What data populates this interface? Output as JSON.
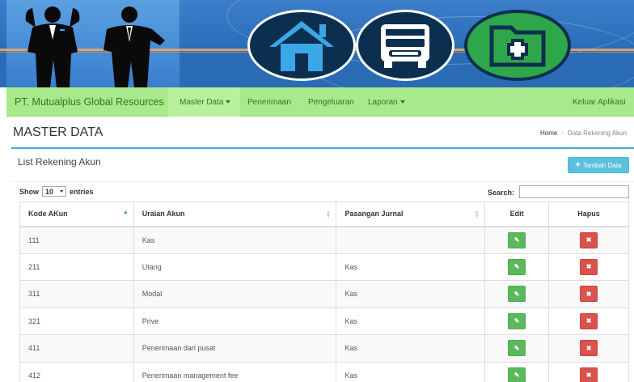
{
  "navbar": {
    "brand": "PT. Mutualplus Global Resources",
    "items": [
      {
        "label": "Master Data",
        "dropdown": true
      },
      {
        "label": "Penerimaan",
        "dropdown": false
      },
      {
        "label": "Pengeluaran",
        "dropdown": false
      },
      {
        "label": "Laporan",
        "dropdown": true
      }
    ],
    "logout": "Keluar Aplikasi"
  },
  "page": {
    "title": "MASTER DATA",
    "breadcrumb": {
      "home": "Home",
      "current": "Data Rekening Akun"
    }
  },
  "panel": {
    "title": "List Rekening Akun",
    "add_button": "Tambah Data",
    "show_label": "Show",
    "entries_value": "10",
    "entries_label": "entries",
    "search_label": "Search:",
    "search_value": ""
  },
  "table": {
    "headers": [
      "Kode AKun",
      "Uraian Akun",
      "Pasangan Jurnal",
      "Edit",
      "Hapus"
    ],
    "rows": [
      {
        "kode": "111",
        "uraian": "Kas",
        "pasangan": ""
      },
      {
        "kode": "211",
        "uraian": "Utang",
        "pasangan": "Kas"
      },
      {
        "kode": "311",
        "uraian": "Modal",
        "pasangan": "Kas"
      },
      {
        "kode": "321",
        "uraian": "Prive",
        "pasangan": "Kas"
      },
      {
        "kode": "411",
        "uraian": "Penerimaan dari pusat",
        "pasangan": "Kas"
      },
      {
        "kode": "412",
        "uraian": "Penerimaan management fee",
        "pasangan": "Kas"
      }
    ]
  },
  "colors": {
    "navbar_bg": "#a8e98c",
    "nav_text": "#2e7a1c",
    "panel_accent": "#3fa9d6",
    "edit_button": "#5cb85c",
    "delete_button": "#d9534f",
    "add_button": "#5bc0de"
  },
  "icons": {
    "banner": [
      "businessman-silhouette-icon",
      "businessman-silhouette-icon",
      "house-icon",
      "bus-icon",
      "folder-add-icon"
    ],
    "edit": "edit-icon",
    "delete": "close-icon",
    "add": "plus-icon"
  }
}
